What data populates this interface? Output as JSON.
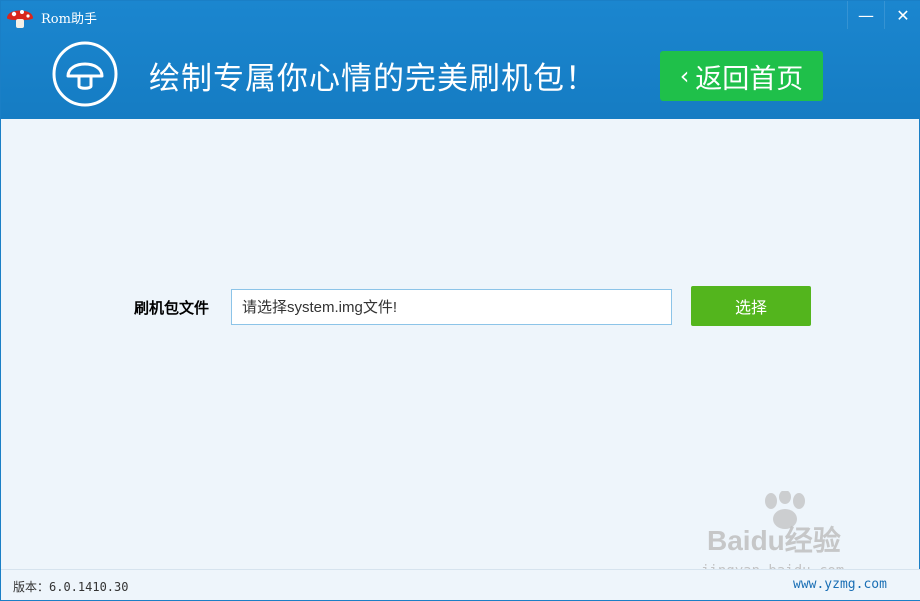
{
  "window": {
    "title": "Rom助手",
    "controls": {
      "minimize": "—",
      "close": "✕"
    }
  },
  "banner": {
    "slogan": "绘制专属你心情的完美刷机包！",
    "home_button_label": "返回首页",
    "home_button_chevron": "‹"
  },
  "form": {
    "label": "刷机包文件",
    "input_placeholder": "请选择system.img文件!",
    "input_value": "",
    "select_button_label": "选择"
  },
  "footer": {
    "version": "版本：6.0.1410.30"
  },
  "watermark": {
    "brand": "Baidu经验",
    "url": "jingyan.baidu.com",
    "site": "www.yzmg.com"
  },
  "colors": {
    "header": "#1b86cf",
    "home_button": "#1fc04a",
    "select_button": "#53b51d",
    "body_bg": "#eef5fb"
  },
  "icons": {
    "app_logo": "mushroom-icon",
    "banner": "mushroom-outline-icon"
  }
}
